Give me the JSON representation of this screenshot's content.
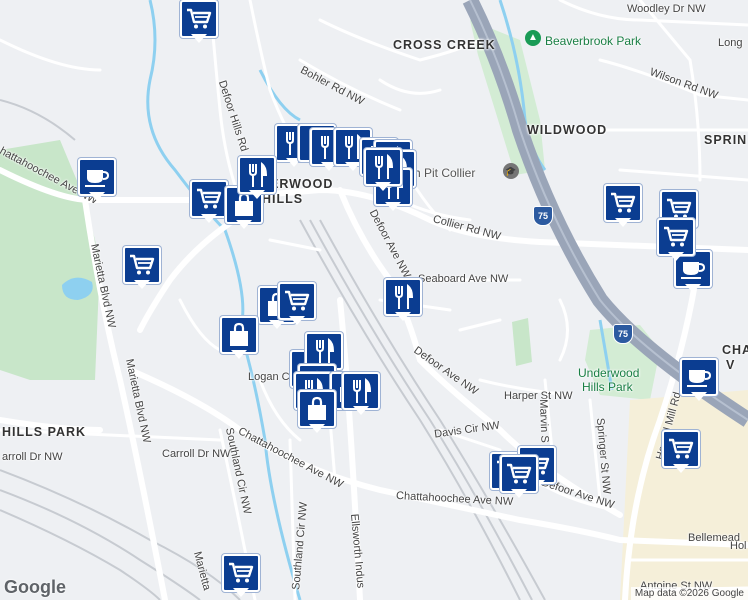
{
  "map": {
    "colors": {
      "background": "#eef0f3",
      "road": "#ffffff",
      "highway": "#9aa5b8",
      "park": "#c8e6c9",
      "water": "#8ed0f0",
      "rail": "#c7cbd1",
      "commercial": "#f5efd9",
      "pin": "#0b3d91"
    },
    "areas": [
      {
        "id": "cross-creek",
        "text": "CROSS CREEK"
      },
      {
        "id": "wildwood",
        "text": "WILDWOOD"
      },
      {
        "id": "spring",
        "text": "SPRIN"
      },
      {
        "id": "underwood-hills-top",
        "text": "ERWOOD"
      },
      {
        "id": "underwood-hills-bottom",
        "text": "HILLS"
      },
      {
        "id": "hills-park",
        "text": "HILLS PARK"
      },
      {
        "id": "chat-v-1",
        "text": "CHA"
      },
      {
        "id": "chat-v-2",
        "text": "V"
      }
    ],
    "pois": [
      {
        "id": "beaverbrook-park",
        "text": "Beaverbrook Park"
      },
      {
        "id": "collier",
        "text": "ch Pit Collier"
      },
      {
        "id": "underwood-park-1",
        "text": "Underwood"
      },
      {
        "id": "underwood-park-2",
        "text": "Hills Park"
      }
    ],
    "roads": [
      {
        "id": "woodley",
        "text": "Woodley Dr NW"
      },
      {
        "id": "long",
        "text": "Long"
      },
      {
        "id": "wilson",
        "text": "Wilson Rd NW"
      },
      {
        "id": "bohler",
        "text": "Bohler Rd NW"
      },
      {
        "id": "defoor-hills",
        "text": "Defoor Hills Rd"
      },
      {
        "id": "chatt-ave-top",
        "text": "hattahoochee Ave NW"
      },
      {
        "id": "marietta-blvd",
        "text": "Marietta Blvd NW"
      },
      {
        "id": "marietta-blvd-2",
        "text": "Marietta Blvd NW"
      },
      {
        "id": "marietta-bottom",
        "text": "Marietta"
      },
      {
        "id": "defoor-ave-1",
        "text": "Defoor Ave NW"
      },
      {
        "id": "collier-rd",
        "text": "Collier Rd NW"
      },
      {
        "id": "seaboard",
        "text": "Seaboard Ave NW"
      },
      {
        "id": "logan",
        "text": "Logan Ci"
      },
      {
        "id": "defoor-ave-2",
        "text": "Defoor Ave NW"
      },
      {
        "id": "harper",
        "text": "Harper St NW"
      },
      {
        "id": "davis",
        "text": "Davis Cir NW"
      },
      {
        "id": "marvin",
        "text": "Marvin S"
      },
      {
        "id": "springer",
        "text": "Springer St NW"
      },
      {
        "id": "howell",
        "text": "Howell Mill Rd"
      },
      {
        "id": "carroll",
        "text": "arroll Dr NW"
      },
      {
        "id": "carroll-2",
        "text": "Carroll Dr NW"
      },
      {
        "id": "chatt-mid",
        "text": "Chattahoochee Ave NW"
      },
      {
        "id": "chatt-bottom",
        "text": "Chattahoochee Ave NW"
      },
      {
        "id": "southland",
        "text": "Southland Cir NW"
      },
      {
        "id": "southland-2",
        "text": "Southland Cir NW"
      },
      {
        "id": "ellsworth",
        "text": "Ellsworth Indus"
      },
      {
        "id": "defoor-ave-3",
        "text": "Defoor Ave NW"
      },
      {
        "id": "bellemeade",
        "text": "Bellemead"
      },
      {
        "id": "hol",
        "text": "Hol"
      },
      {
        "id": "antoine",
        "text": "Antoine St NW"
      }
    ],
    "shields": [
      {
        "id": "i75-top",
        "text": "75"
      },
      {
        "id": "i75-mid",
        "text": "75"
      }
    ],
    "pins": [
      {
        "type": "shopping-cart"
      },
      {
        "type": "coffee-cup"
      },
      {
        "type": "shopping-cart"
      },
      {
        "type": "shopping-bag"
      },
      {
        "type": "fork-knife"
      },
      {
        "type": "fork-knife"
      },
      {
        "type": "fork-knife"
      },
      {
        "type": "fork-knife"
      },
      {
        "type": "fork-knife"
      },
      {
        "type": "fork-knife"
      },
      {
        "type": "fork-knife"
      },
      {
        "type": "fork-knife"
      },
      {
        "type": "fork-knife"
      },
      {
        "type": "shopping-cart"
      },
      {
        "type": "shopping-bag"
      },
      {
        "type": "shopping-cart"
      },
      {
        "type": "shopping-bag"
      },
      {
        "type": "shopping-bag"
      },
      {
        "type": "fork-knife"
      },
      {
        "type": "shopping-bag"
      },
      {
        "type": "fork-knife"
      },
      {
        "type": "shopping-bag"
      },
      {
        "type": "fork-knife"
      },
      {
        "type": "shopping-bag"
      },
      {
        "type": "shopping-cart"
      },
      {
        "type": "shopping-cart"
      },
      {
        "type": "shopping-cart"
      },
      {
        "type": "shopping-cart"
      },
      {
        "type": "coffee-cup"
      },
      {
        "type": "coffee-cup"
      },
      {
        "type": "shopping-cart"
      },
      {
        "type": "shopping-cart"
      },
      {
        "type": "shopping-cart"
      },
      {
        "type": "shopping-cart"
      },
      {
        "type": "fork-knife"
      },
      {
        "type": "fork-knife"
      }
    ],
    "attribution": "Map data ©2026 Google",
    "logo": "Google"
  }
}
